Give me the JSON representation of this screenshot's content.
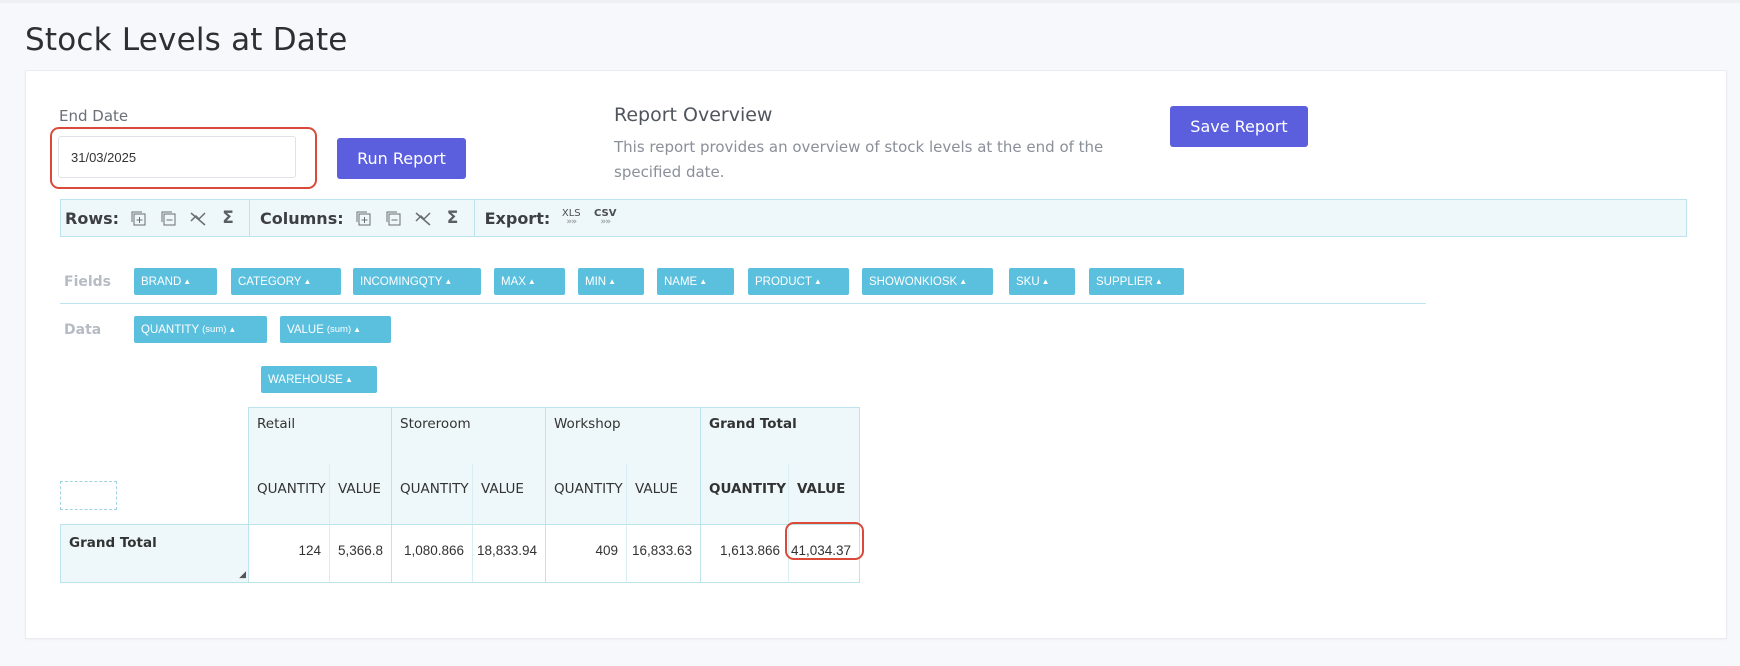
{
  "page": {
    "title": "Stock Levels at Date"
  },
  "form": {
    "end_date_label": "End Date",
    "end_date_value": "31/03/2025",
    "run_button": "Run Report",
    "save_button": "Save Report"
  },
  "overview": {
    "title": "Report Overview",
    "text": "This report provides an overview of stock levels at the end of the specified date."
  },
  "toolbar": {
    "rows_label": "Rows:",
    "columns_label": "Columns:",
    "export_label": "Export:",
    "xls": "XLS",
    "csv": "CSV"
  },
  "fields": {
    "label": "Fields",
    "items": [
      "BRAND",
      "CATEGORY",
      "INCOMINGQTY",
      "MAX",
      "MIN",
      "NAME",
      "PRODUCT",
      "SHOWONKIOSK",
      "SKU",
      "SUPPLIER"
    ]
  },
  "data_fields": {
    "label": "Data",
    "items": [
      {
        "name": "QUANTITY",
        "agg": "(sum)"
      },
      {
        "name": "VALUE",
        "agg": "(sum)"
      }
    ]
  },
  "column_field": "WAREHOUSE",
  "pivot": {
    "warehouses": [
      "Retail",
      "Storeroom",
      "Workshop",
      "Grand Total"
    ],
    "measures": [
      "QUANTITY",
      "VALUE"
    ],
    "row_label": "Grand Total",
    "values": [
      "124",
      "5,366.8",
      "1,080.866",
      "18,833.94",
      "409",
      "16,833.63",
      "1,613.866",
      "41,034.37"
    ]
  },
  "colors": {
    "accent": "#5b5fde",
    "chip": "#5bc0de",
    "highlight": "#d94a3a"
  }
}
